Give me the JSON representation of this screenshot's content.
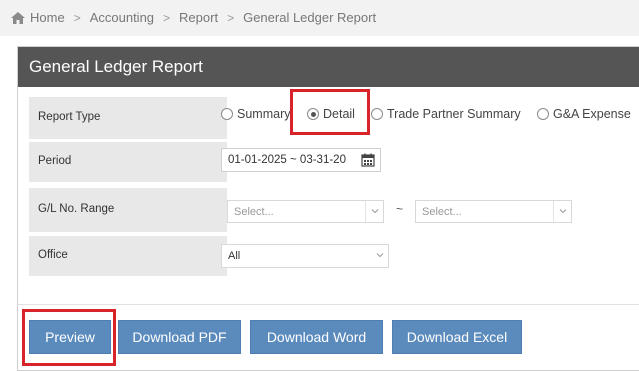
{
  "breadcrumb": {
    "items": [
      "Home",
      "Accounting",
      "Report",
      "General Ledger Report"
    ],
    "separator": ">"
  },
  "panel": {
    "title": "General Ledger Report"
  },
  "form": {
    "report_type": {
      "label": "Report Type",
      "options": [
        "Summary",
        "Detail",
        "Trade Partner Summary",
        "G&A Expense"
      ],
      "selected": "Detail"
    },
    "period": {
      "label": "Period",
      "value": "01-01-2025 ~ 03-31-20",
      "icon": "calendar-icon"
    },
    "gl_range": {
      "label": "G/L No. Range",
      "from_placeholder": "Select...",
      "tilde": "~",
      "to_placeholder": "Select..."
    },
    "office": {
      "label": "Office",
      "value": "All"
    }
  },
  "buttons": {
    "preview": "Preview",
    "download_pdf": "Download PDF",
    "download_word": "Download Word",
    "download_excel": "Download Excel"
  },
  "colors": {
    "header_bg": "#555555",
    "label_bg": "#e8e8e8",
    "button_bg": "#5b8bbd",
    "highlight": "#d9232a",
    "breadcrumb_bg": "#f2f2f2"
  }
}
